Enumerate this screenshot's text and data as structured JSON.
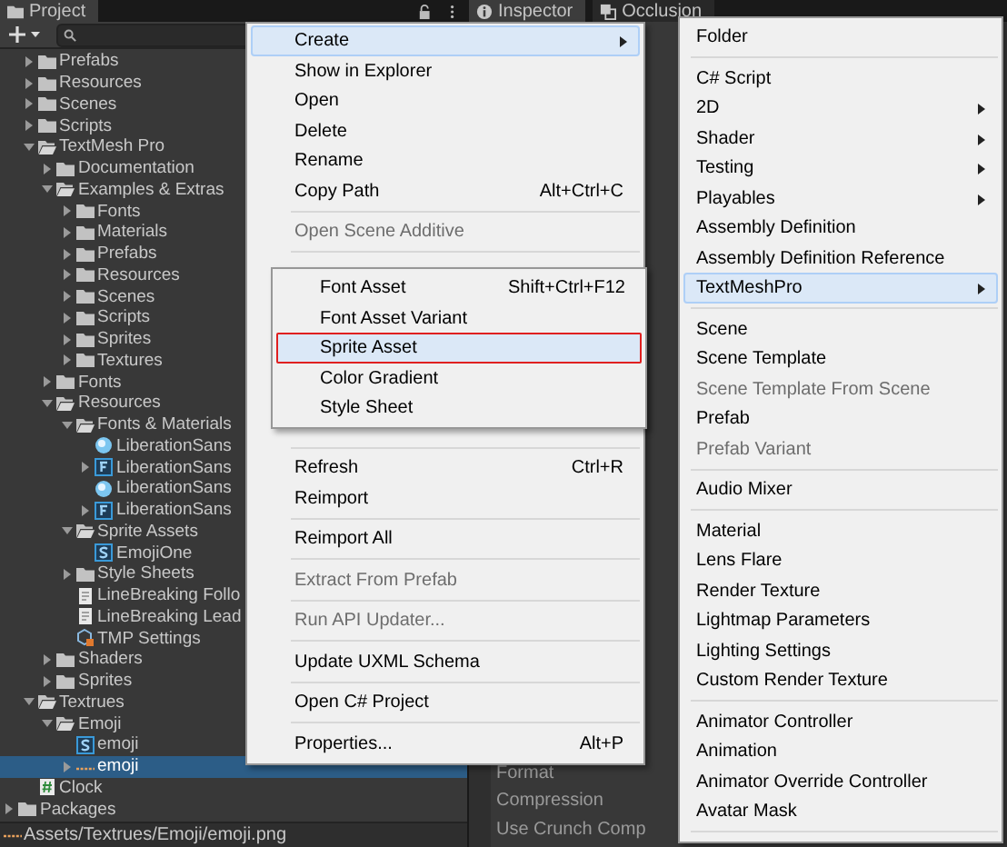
{
  "project_panel": {
    "tab": "Project",
    "tree": [
      {
        "label": "Prefabs",
        "kind": "folder",
        "expanded": false,
        "selected": false
      },
      {
        "label": "Resources",
        "kind": "folder",
        "expanded": false,
        "selected": false
      },
      {
        "label": "Scenes",
        "kind": "folder",
        "expanded": false,
        "selected": false
      },
      {
        "label": "Scripts",
        "kind": "folder",
        "expanded": false,
        "selected": false
      },
      {
        "label": "TextMesh Pro",
        "kind": "folder-open",
        "expanded": true,
        "selected": false,
        "children": [
          {
            "label": "Documentation",
            "kind": "folder",
            "expanded": false,
            "selected": false
          },
          {
            "label": "Examples & Extras",
            "kind": "folder-open",
            "expanded": true,
            "selected": false,
            "children": [
              {
                "label": "Fonts",
                "kind": "folder",
                "expanded": false,
                "selected": false
              },
              {
                "label": "Materials",
                "kind": "folder",
                "expanded": false,
                "selected": false
              },
              {
                "label": "Prefabs",
                "kind": "folder",
                "expanded": false,
                "selected": false
              },
              {
                "label": "Resources",
                "kind": "folder",
                "expanded": false,
                "selected": false
              },
              {
                "label": "Scenes",
                "kind": "folder",
                "expanded": false,
                "selected": false
              },
              {
                "label": "Scripts",
                "kind": "folder",
                "expanded": false,
                "selected": false
              },
              {
                "label": "Sprites",
                "kind": "folder",
                "expanded": false,
                "selected": false
              },
              {
                "label": "Textures",
                "kind": "folder",
                "expanded": false,
                "selected": false
              }
            ]
          },
          {
            "label": "Fonts",
            "kind": "folder",
            "expanded": false,
            "selected": false
          },
          {
            "label": "Resources",
            "kind": "folder-open",
            "expanded": true,
            "selected": false,
            "children": [
              {
                "label": "Fonts & Materials",
                "kind": "folder-open",
                "expanded": true,
                "selected": false,
                "children": [
                  {
                    "label": "LiberationSans",
                    "kind": "material",
                    "selected": false
                  },
                  {
                    "label": "LiberationSans",
                    "kind": "font",
                    "expanded": false,
                    "selected": false
                  },
                  {
                    "label": "LiberationSans",
                    "kind": "material",
                    "selected": false
                  },
                  {
                    "label": "LiberationSans",
                    "kind": "font",
                    "expanded": false,
                    "selected": false
                  }
                ]
              },
              {
                "label": "Sprite Assets",
                "kind": "folder-open",
                "expanded": true,
                "selected": false,
                "children": [
                  {
                    "label": "EmojiOne",
                    "kind": "sprite",
                    "selected": false
                  }
                ]
              },
              {
                "label": "Style Sheets",
                "kind": "folder",
                "expanded": false,
                "selected": false
              },
              {
                "label": "LineBreaking Follo",
                "kind": "text",
                "selected": false
              },
              {
                "label": "LineBreaking Lead",
                "kind": "text",
                "selected": false
              },
              {
                "label": "TMP Settings",
                "kind": "settings",
                "selected": false
              }
            ]
          },
          {
            "label": "Shaders",
            "kind": "folder",
            "expanded": false,
            "selected": false
          },
          {
            "label": "Sprites",
            "kind": "folder",
            "expanded": false,
            "selected": false
          }
        ]
      },
      {
        "label": "Textrues",
        "kind": "folder-open",
        "expanded": true,
        "selected": false,
        "children": [
          {
            "label": "Emoji",
            "kind": "folder-open",
            "expanded": true,
            "selected": false,
            "children": [
              {
                "label": "emoji",
                "kind": "sprite",
                "selected": false
              },
              {
                "label": "emoji",
                "kind": "texture",
                "expanded": false,
                "selected": true
              }
            ]
          }
        ]
      },
      {
        "label": "Clock",
        "kind": "script",
        "selected": false
      }
    ],
    "root_items": [
      {
        "label": "Packages",
        "kind": "folder",
        "expanded": false,
        "selected": false
      }
    ],
    "status_path": "Assets/Textrues/Emoji/emoji.png"
  },
  "inspector_panel": {
    "tabs": [
      {
        "label": "Inspector",
        "kind": "info",
        "selected": true
      },
      {
        "label": "Occlusion",
        "kind": "occlusion",
        "selected": false
      }
    ],
    "labels": [
      "Format",
      "Compression",
      "Use Crunch Comp"
    ]
  },
  "context_menu": {
    "items_top": [
      {
        "kind": "item",
        "label": "Create",
        "submenu": true,
        "disabled": false,
        "highlighted": true
      },
      {
        "kind": "item",
        "label": "Show in Explorer",
        "submenu": false,
        "disabled": false,
        "highlighted": false
      },
      {
        "kind": "item",
        "label": "Open",
        "submenu": false,
        "disabled": false,
        "highlighted": false
      },
      {
        "kind": "item",
        "label": "Delete",
        "submenu": false,
        "disabled": false,
        "highlighted": false
      },
      {
        "kind": "item",
        "label": "Rename",
        "submenu": false,
        "disabled": false,
        "highlighted": false
      },
      {
        "kind": "item",
        "label": "Copy Path",
        "shortcut": "Alt+Ctrl+C",
        "submenu": false,
        "disabled": false,
        "highlighted": false
      },
      {
        "kind": "separator"
      },
      {
        "kind": "item",
        "label": "Open Scene Additive",
        "submenu": false,
        "disabled": true,
        "highlighted": false
      },
      {
        "kind": "separator"
      }
    ],
    "items_bottom": [
      {
        "kind": "separator"
      },
      {
        "kind": "item",
        "label": "Refresh",
        "shortcut": "Ctrl+R",
        "submenu": false,
        "disabled": false,
        "highlighted": false
      },
      {
        "kind": "item",
        "label": "Reimport",
        "submenu": false,
        "disabled": false,
        "highlighted": false
      },
      {
        "kind": "separator"
      },
      {
        "kind": "item",
        "label": "Reimport All",
        "submenu": false,
        "disabled": false,
        "highlighted": false
      },
      {
        "kind": "separator"
      },
      {
        "kind": "item",
        "label": "Extract From Prefab",
        "submenu": false,
        "disabled": true,
        "highlighted": false
      },
      {
        "kind": "separator"
      },
      {
        "kind": "item",
        "label": "Run API Updater...",
        "submenu": false,
        "disabled": true,
        "highlighted": false
      },
      {
        "kind": "separator"
      },
      {
        "kind": "item",
        "label": "Update UXML Schema",
        "submenu": false,
        "disabled": false,
        "highlighted": false
      },
      {
        "kind": "separator"
      },
      {
        "kind": "item",
        "label": "Open C# Project",
        "submenu": false,
        "disabled": false,
        "highlighted": false
      },
      {
        "kind": "separator"
      },
      {
        "kind": "item",
        "label": "Properties...",
        "shortcut": "Alt+P",
        "submenu": false,
        "disabled": false,
        "highlighted": false
      }
    ]
  },
  "textmeshpro_submenu": {
    "items": [
      {
        "label": "Font Asset",
        "shortcut": "Shift+Ctrl+F12",
        "highlighted": false,
        "annotated": false
      },
      {
        "label": "Font Asset Variant",
        "highlighted": false,
        "annotated": false
      },
      {
        "label": "Sprite Asset",
        "highlighted": true,
        "annotated": true
      },
      {
        "label": "Color Gradient",
        "highlighted": false,
        "annotated": false
      },
      {
        "label": "Style Sheet",
        "highlighted": false,
        "annotated": false
      }
    ]
  },
  "create_submenu": {
    "items": [
      {
        "kind": "item",
        "label": "Folder",
        "submenu": false,
        "disabled": false,
        "highlighted": false
      },
      {
        "kind": "separator"
      },
      {
        "kind": "item",
        "label": "C# Script",
        "submenu": false,
        "disabled": false,
        "highlighted": false
      },
      {
        "kind": "item",
        "label": "2D",
        "submenu": true,
        "disabled": false,
        "highlighted": false
      },
      {
        "kind": "item",
        "label": "Shader",
        "submenu": true,
        "disabled": false,
        "highlighted": false
      },
      {
        "kind": "item",
        "label": "Testing",
        "submenu": true,
        "disabled": false,
        "highlighted": false
      },
      {
        "kind": "item",
        "label": "Playables",
        "submenu": true,
        "disabled": false,
        "highlighted": false
      },
      {
        "kind": "item",
        "label": "Assembly Definition",
        "submenu": false,
        "disabled": false,
        "highlighted": false
      },
      {
        "kind": "item",
        "label": "Assembly Definition Reference",
        "submenu": false,
        "disabled": false,
        "highlighted": false
      },
      {
        "kind": "item",
        "label": "TextMeshPro",
        "submenu": true,
        "disabled": false,
        "highlighted": true
      },
      {
        "kind": "separator"
      },
      {
        "kind": "item",
        "label": "Scene",
        "submenu": false,
        "disabled": false,
        "highlighted": false
      },
      {
        "kind": "item",
        "label": "Scene Template",
        "submenu": false,
        "disabled": false,
        "highlighted": false
      },
      {
        "kind": "item",
        "label": "Scene Template From Scene",
        "submenu": false,
        "disabled": true,
        "highlighted": false
      },
      {
        "kind": "item",
        "label": "Prefab",
        "submenu": false,
        "disabled": false,
        "highlighted": false
      },
      {
        "kind": "item",
        "label": "Prefab Variant",
        "submenu": false,
        "disabled": true,
        "highlighted": false
      },
      {
        "kind": "separator"
      },
      {
        "kind": "item",
        "label": "Audio Mixer",
        "submenu": false,
        "disabled": false,
        "highlighted": false
      },
      {
        "kind": "separator"
      },
      {
        "kind": "item",
        "label": "Material",
        "submenu": false,
        "disabled": false,
        "highlighted": false
      },
      {
        "kind": "item",
        "label": "Lens Flare",
        "submenu": false,
        "disabled": false,
        "highlighted": false
      },
      {
        "kind": "item",
        "label": "Render Texture",
        "submenu": false,
        "disabled": false,
        "highlighted": false
      },
      {
        "kind": "item",
        "label": "Lightmap Parameters",
        "submenu": false,
        "disabled": false,
        "highlighted": false
      },
      {
        "kind": "item",
        "label": "Lighting Settings",
        "submenu": false,
        "disabled": false,
        "highlighted": false
      },
      {
        "kind": "item",
        "label": "Custom Render Texture",
        "submenu": false,
        "disabled": false,
        "highlighted": false
      },
      {
        "kind": "separator"
      },
      {
        "kind": "item",
        "label": "Animator Controller",
        "submenu": false,
        "disabled": false,
        "highlighted": false
      },
      {
        "kind": "item",
        "label": "Animation",
        "submenu": false,
        "disabled": false,
        "highlighted": false
      },
      {
        "kind": "item",
        "label": "Animator Override Controller",
        "submenu": false,
        "disabled": false,
        "highlighted": false
      },
      {
        "kind": "item",
        "label": "Avatar Mask",
        "submenu": false,
        "disabled": false,
        "highlighted": false
      },
      {
        "kind": "separator"
      }
    ]
  }
}
